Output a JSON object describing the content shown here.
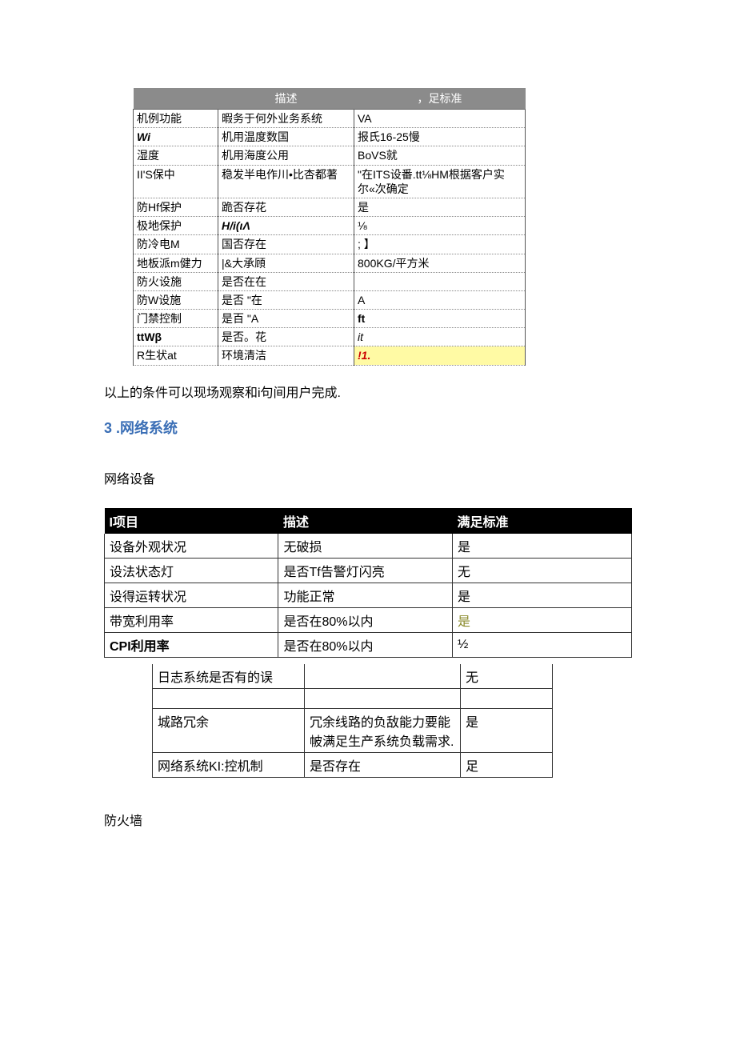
{
  "table1": {
    "headers": [
      "",
      "描述",
      "，足标准"
    ],
    "rows": [
      {
        "c0": "机例功能",
        "c1": "暇务于何外业务系统",
        "c2": "VA"
      },
      {
        "c0": "Wi",
        "c0_style": "bold italic",
        "c1": "机用温度数国",
        "c2": "报氏16-25慢"
      },
      {
        "c0": "湿度",
        "c1": "机用海度公用",
        "c2": "BoVS就"
      },
      {
        "c0": "II'S保中",
        "c1": "稳发半电作川•比杏都著",
        "c2": "\"在ITS设番.tt⅛HM根据客户实尔«次确定"
      },
      {
        "c0": "防Hf保护",
        "c1": "跪否存花",
        "c2": "是"
      },
      {
        "c0": "极地保护",
        "c1": "H/i(ιΛ",
        "c1_style": "bold italic",
        "c2": "⅛"
      },
      {
        "c0": "防冷电M",
        "c1": "国否存在",
        "c2": "; 】"
      },
      {
        "c0": "地板派m健力",
        "c1": "|&大承頋",
        "c2": "800KG/平方米"
      },
      {
        "c0": "防火设施",
        "c1": "是否在在",
        "c2": ""
      },
      {
        "c0": "防W设施",
        "c1": "是否 \"在",
        "c2": "A"
      },
      {
        "c0": "门禁控制",
        "c1": "是百 \"A",
        "c2": "ft",
        "c2_style": "bold"
      },
      {
        "c0": "ttWβ",
        "c0_style": "bold",
        "c1": "是否。花",
        "c2": "it",
        "c2_style": "italic"
      },
      {
        "c0": "R生状at",
        "c1": "环境清洁",
        "c2": "!1.",
        "c2_style": "highlight"
      }
    ]
  },
  "para1": "以上的条件可以现场观察和i句间用户完成.",
  "heading3": "3 .网络系统",
  "sub1": "网络设备",
  "table2": {
    "headers": [
      "I项目",
      "描述",
      "满足标准"
    ],
    "rows": [
      {
        "c0": "设备外观状况",
        "c1": "无破损",
        "c2": "是"
      },
      {
        "c0": "设法状态灯",
        "c1": "是否Tf告警灯闪亮",
        "c2": "无"
      },
      {
        "c0": "设得运转状况",
        "c1": "功能正常",
        "c2": "是"
      },
      {
        "c0": "带宽利用率",
        "c1": "是否在80%以内",
        "c2": "是",
        "c2_style": "olive"
      },
      {
        "c0": "CPI利用率",
        "c0_style": "bold",
        "c1": "是否在80%以内",
        "c2": "½"
      }
    ]
  },
  "table3": {
    "rows": [
      {
        "c0": "日志系统是否有的误",
        "c1": "",
        "c2": "无"
      },
      {
        "blank": true
      },
      {
        "c0": "城路冗余",
        "c1": "冗余线路的负敌能力要能帔满足生产系统负载需求.",
        "c2": "是"
      },
      {
        "c0": "网络系统KI:控机制",
        "c1": "是否存在",
        "c2": "足"
      }
    ]
  },
  "sub2": "防火墙"
}
